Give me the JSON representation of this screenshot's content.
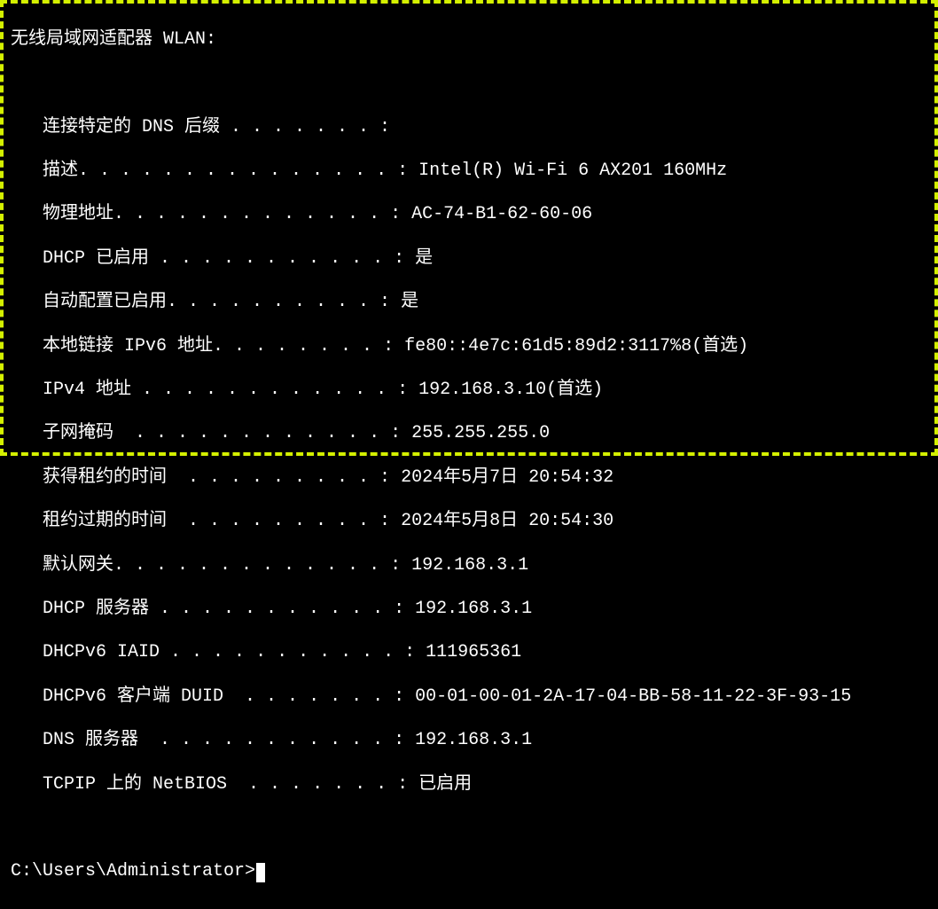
{
  "header": "无线局域网适配器 WLAN:",
  "blankColon": "",
  "entries": [
    {
      "label": "连接特定的 DNS 后缀",
      "fill": " . . . . . . . :",
      "value": ""
    },
    {
      "label": "描述",
      "fill": ". . . . . . . . . . . . . . . :",
      "value": "Intel(R) Wi-Fi 6 AX201 160MHz"
    },
    {
      "label": "物理地址",
      "fill": ". . . . . . . . . . . . . :",
      "value": "AC-74-B1-62-60-06"
    },
    {
      "label": "DHCP 已启用",
      "fill": " . . . . . . . . . . . :",
      "value": "是"
    },
    {
      "label": "自动配置已启用",
      "fill": ". . . . . . . . . . :",
      "value": "是"
    },
    {
      "label": "本地链接 IPv6 地址",
      "fill": ". . . . . . . . :",
      "value": "fe80::4e7c:61d5:89d2:3117%8(首选)"
    },
    {
      "label": "IPv4 地址",
      "fill": " . . . . . . . . . . . . :",
      "value": "192.168.3.10(首选)"
    },
    {
      "label": "子网掩码",
      "fill": "  . . . . . . . . . . . . :",
      "value": "255.255.255.0"
    },
    {
      "label": "获得租约的时间",
      "fill": "  . . . . . . . . . :",
      "value": "2024年5月7日 20:54:32"
    },
    {
      "label": "租约过期的时间",
      "fill": "  . . . . . . . . . :",
      "value": "2024年5月8日 20:54:30"
    },
    {
      "label": "默认网关",
      "fill": ". . . . . . . . . . . . . :",
      "value": "192.168.3.1"
    },
    {
      "label": "DHCP 服务器",
      "fill": " . . . . . . . . . . . :",
      "value": "192.168.3.1"
    },
    {
      "label": "DHCPv6 IAID",
      "fill": " . . . . . . . . . . . :",
      "value": "111965361"
    },
    {
      "label": "DHCPv6 客户端 DUID",
      "fill": "  . . . . . . . :",
      "value": "00-01-00-01-2A-17-04-BB-58-11-22-3F-93-15"
    },
    {
      "label": "DNS 服务器",
      "fill": "  . . . . . . . . . . . :",
      "value": "192.168.3.1"
    },
    {
      "label": "TCPIP 上的 NetBIOS",
      "fill": "  . . . . . . . :",
      "value": "已启用"
    }
  ],
  "prompt": "C:\\Users\\Administrator>"
}
